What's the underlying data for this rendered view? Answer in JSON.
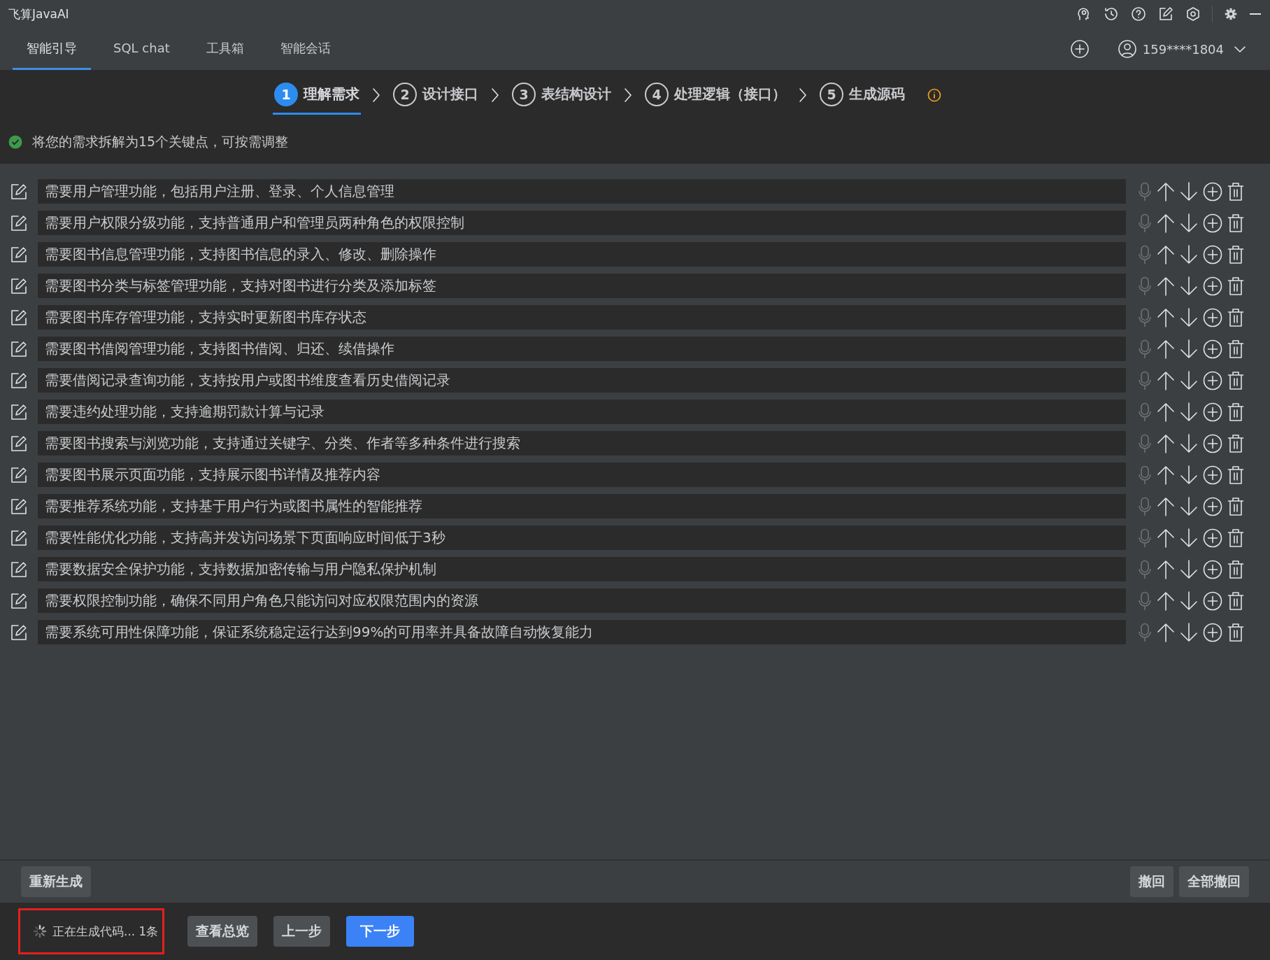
{
  "window": {
    "title": "飞算JavaAI"
  },
  "tabs": [
    {
      "label": "智能引导",
      "selected": true
    },
    {
      "label": "SQL chat",
      "selected": false
    },
    {
      "label": "工具箱",
      "selected": false
    },
    {
      "label": "智能会话",
      "selected": false
    }
  ],
  "account": {
    "user": "159****1804"
  },
  "steps": [
    {
      "number": "1",
      "label": "理解需求",
      "selected": true
    },
    {
      "number": "2",
      "label": "设计接口",
      "selected": false
    },
    {
      "number": "3",
      "label": "表结构设计",
      "selected": false
    },
    {
      "number": "4",
      "label": "处理逻辑（接口）",
      "selected": false
    },
    {
      "number": "5",
      "label": "生成源码",
      "selected": false
    }
  ],
  "status_message": "将您的需求拆解为15个关键点，可按需调整",
  "key_points": [
    {
      "text": "需要用户管理功能，包括用户注册、登录、个人信息管理"
    },
    {
      "text": "需要用户权限分级功能，支持普通用户和管理员两种角色的权限控制"
    },
    {
      "text": "需要图书信息管理功能，支持图书信息的录入、修改、删除操作"
    },
    {
      "text": "需要图书分类与标签管理功能，支持对图书进行分类及添加标签"
    },
    {
      "text": "需要图书库存管理功能，支持实时更新图书库存状态"
    },
    {
      "text": "需要图书借阅管理功能，支持图书借阅、归还、续借操作"
    },
    {
      "text": "需要借阅记录查询功能，支持按用户或图书维度查看历史借阅记录"
    },
    {
      "text": "需要违约处理功能，支持逾期罚款计算与记录"
    },
    {
      "text": "需要图书搜索与浏览功能，支持通过关键字、分类、作者等多种条件进行搜索"
    },
    {
      "text": "需要图书展示页面功能，支持展示图书详情及推荐内容"
    },
    {
      "text": "需要推荐系统功能，支持基于用户行为或图书属性的智能推荐"
    },
    {
      "text": "需要性能优化功能，支持高并发访问场景下页面响应时间低于3秒"
    },
    {
      "text": "需要数据安全保护功能，支持数据加密传输与用户隐私保护机制"
    },
    {
      "text": "需要权限控制功能，确保不同用户角色只能访问对应权限范围内的资源"
    },
    {
      "text": "需要系统可用性保障功能，保证系统稳定运行达到99%的可用率并具备故障自动恢复能力"
    }
  ],
  "action_bar": {
    "left": [
      "重新生成"
    ],
    "right": [
      "撤回",
      "全部撤回"
    ]
  },
  "footer": {
    "progress": {
      "text": "正在生成代码... 1条",
      "highlighted": true
    },
    "buttons": [
      {
        "label": "查看总览",
        "kind": "secondary"
      },
      {
        "label": "上一步",
        "kind": "secondary"
      },
      {
        "label": "下一步",
        "kind": "primary"
      }
    ]
  }
}
